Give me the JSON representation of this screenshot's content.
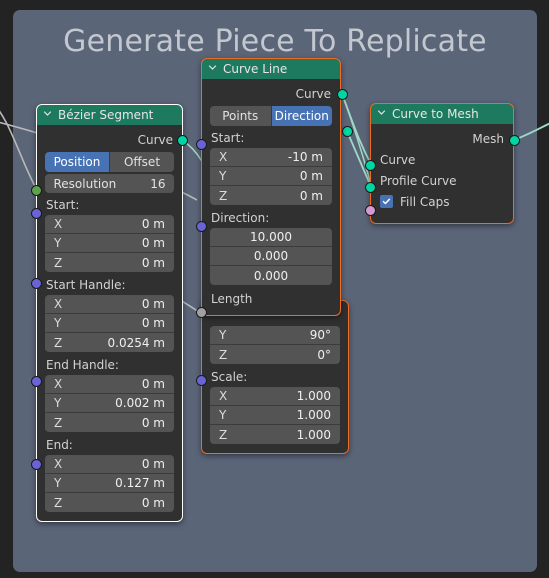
{
  "frame": {
    "title": "Generate Piece To Replicate",
    "bg_color": "#5b6578",
    "title_color": "#c3c7cf"
  },
  "editor": {
    "background_color": "#232323",
    "node_body_color": "#303030",
    "header_color": "#1e7a5e",
    "accent_blue": "#4772b3",
    "selection_orange": "#ed6c23",
    "selection_white": "#ffffff"
  },
  "nodes": [
    {
      "id": "bezier_segment",
      "title": "Bézier Segment",
      "selected": "white",
      "outputs": [
        {
          "name": "Curve",
          "type": "geometry"
        }
      ],
      "toggles": {
        "options": [
          "Position",
          "Offset"
        ],
        "active": "Position"
      },
      "resolution": {
        "label": "Resolution",
        "value": "16"
      },
      "sections": [
        {
          "label": "Start:",
          "fields": [
            {
              "name": "X",
              "value": "0 m"
            },
            {
              "name": "Y",
              "value": "0 m"
            },
            {
              "name": "Z",
              "value": "0 m"
            }
          ]
        },
        {
          "label": "Start Handle:",
          "fields": [
            {
              "name": "X",
              "value": "0 m"
            },
            {
              "name": "Y",
              "value": "0 m"
            },
            {
              "name": "Z",
              "value": "0.0254 m"
            }
          ]
        },
        {
          "label": "End Handle:",
          "fields": [
            {
              "name": "X",
              "value": "0 m"
            },
            {
              "name": "Y",
              "value": "0.002 m"
            },
            {
              "name": "Z",
              "value": "0 m"
            }
          ]
        },
        {
          "label": "End:",
          "fields": [
            {
              "name": "X",
              "value": "0 m"
            },
            {
              "name": "Y",
              "value": "0.127 m"
            },
            {
              "name": "Z",
              "value": "0 m"
            }
          ]
        }
      ]
    },
    {
      "id": "curve_line",
      "title": "Curve Line",
      "selected": "orange",
      "outputs": [
        {
          "name": "Curve",
          "type": "geometry"
        }
      ],
      "toggles": {
        "options": [
          "Points",
          "Direction"
        ],
        "active": "Direction"
      },
      "start": {
        "label": "Start:",
        "fields": [
          {
            "name": "X",
            "value": "-10 m"
          },
          {
            "name": "Y",
            "value": "0 m"
          },
          {
            "name": "Z",
            "value": "0 m"
          }
        ]
      },
      "direction": {
        "label": "Direction:",
        "values": [
          "10.000",
          "0.000",
          "0.000"
        ]
      },
      "length": {
        "label": "Length"
      }
    },
    {
      "id": "transform_geometry",
      "title": "",
      "selected": "orange",
      "rotation": {
        "fields": [
          {
            "name": "Y",
            "value": "90°"
          },
          {
            "name": "Z",
            "value": "0°"
          }
        ]
      },
      "scale": {
        "label": "Scale:",
        "fields": [
          {
            "name": "X",
            "value": "1.000"
          },
          {
            "name": "Y",
            "value": "1.000"
          },
          {
            "name": "Z",
            "value": "1.000"
          }
        ]
      }
    },
    {
      "id": "curve_to_mesh",
      "title": "Curve to Mesh",
      "selected": "orange",
      "outputs": [
        {
          "name": "Mesh",
          "type": "geometry"
        }
      ],
      "inputs": [
        {
          "name": "Curve",
          "type": "geometry"
        },
        {
          "name": "Profile Curve",
          "type": "geometry"
        },
        {
          "name": "Fill Caps",
          "type": "boolean",
          "checked": true
        }
      ]
    }
  ]
}
